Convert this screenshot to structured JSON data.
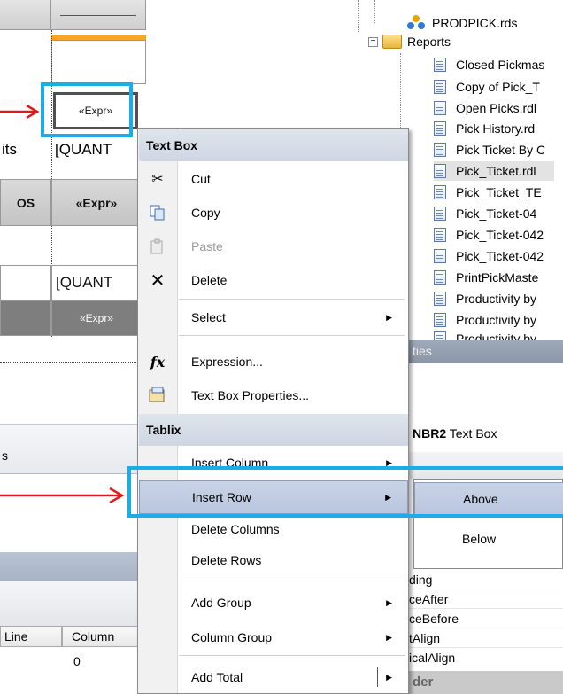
{
  "design": {
    "expr": "«Expr»",
    "quantity": "[QUANT",
    "its": "its",
    "os": "OS",
    "lower_tab": "s",
    "grid_headers": [
      "Line",
      "Column"
    ],
    "grid_value": "0"
  },
  "solution_tree": {
    "data_source": "PRODPICK.rds",
    "folder": "Reports",
    "items": [
      "Closed Pickmas",
      "Copy of Pick_T",
      "Open Picks.rdl",
      "Pick History.rd",
      "Pick Ticket By C",
      "Pick_Ticket.rdl",
      "Pick_Ticket_TE",
      "Pick_Ticket-04",
      "Pick_Ticket-042",
      "Pick_Ticket-042",
      "PrintPickMaste",
      "Productivity by",
      "Productivity by",
      "Productivity by"
    ]
  },
  "properties": {
    "title_fragment": "ties",
    "object_name": "NBR2",
    "object_type": "Text Box",
    "rows": [
      "ding",
      "ceAfter",
      "ceBefore",
      "tAlign",
      "icalAlign"
    ],
    "section": "der"
  },
  "context_menu": {
    "text_box_header": "Text Box",
    "cut": "Cut",
    "copy": "Copy",
    "paste": "Paste",
    "delete": "Delete",
    "select": "Select",
    "expression": "Expression...",
    "text_box_properties": "Text Box Properties...",
    "tablix_header": "Tablix",
    "insert_column": "Insert Column",
    "insert_row": "Insert Row",
    "delete_columns": "Delete Columns",
    "delete_rows": "Delete Rows",
    "add_group": "Add Group",
    "column_group": "Column Group",
    "add_total": "Add Total"
  },
  "submenu": {
    "above": "Above",
    "below": "Below"
  },
  "colors": {
    "highlight_box": "#1aaee6",
    "arrow": "#e0191b",
    "menu_highlight": "#c3cde3",
    "selection_bar": "#f6a623"
  }
}
